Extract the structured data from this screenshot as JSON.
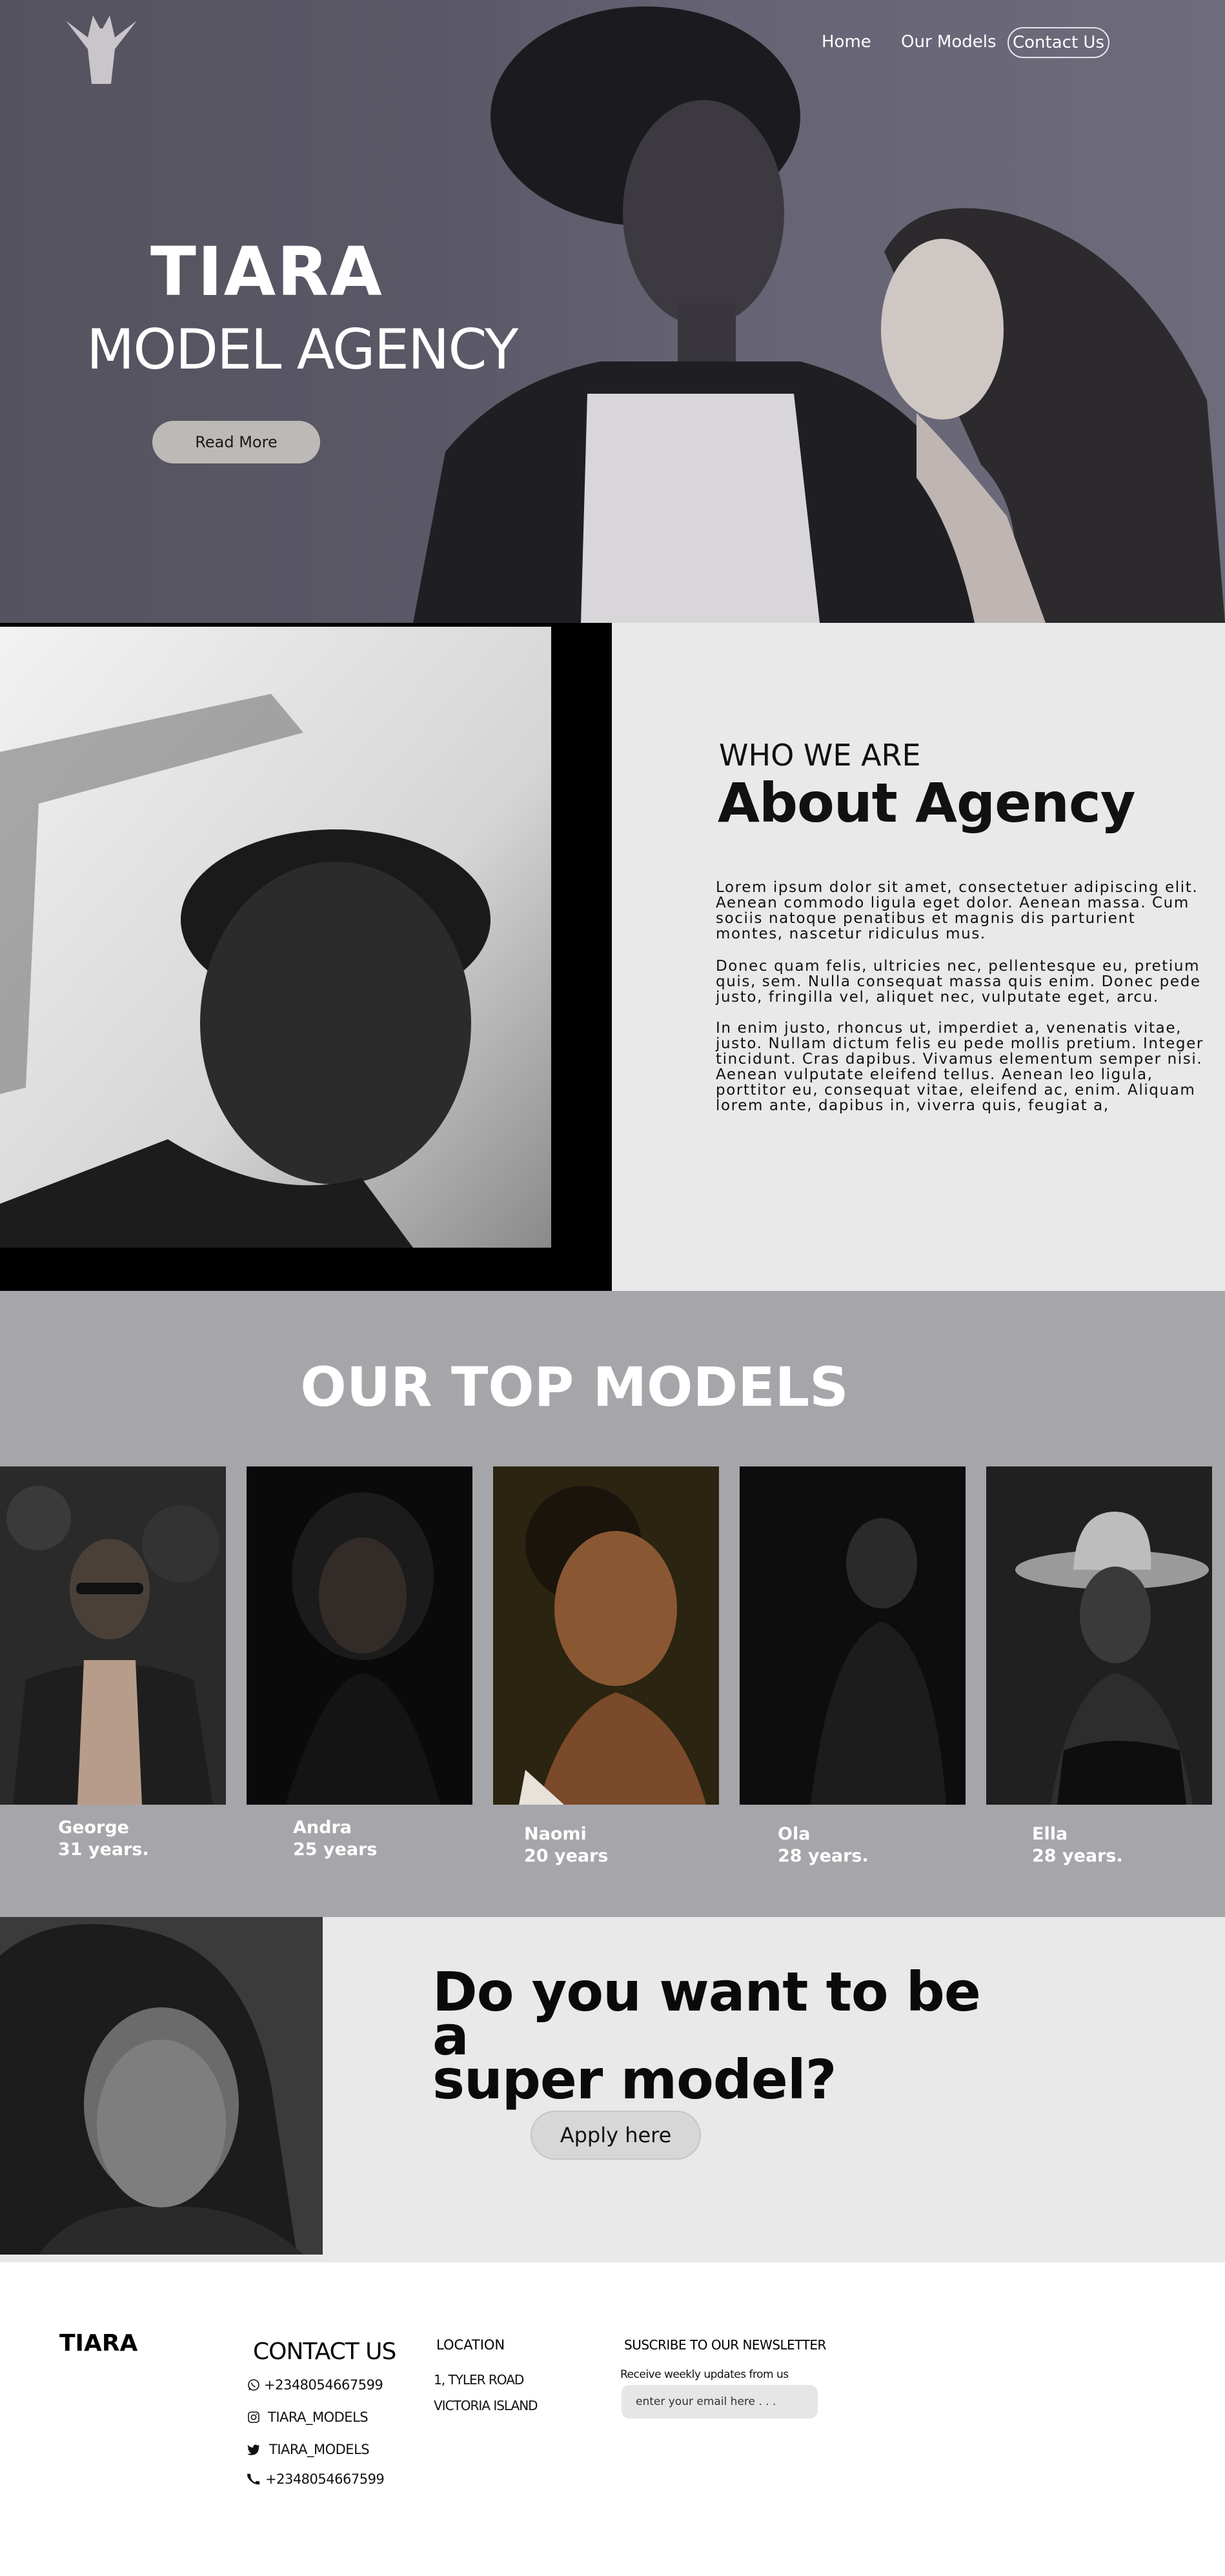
{
  "brand": {
    "logo_icon": "crown-figure-logo-icon"
  },
  "nav": {
    "items": [
      {
        "label": "Home"
      },
      {
        "label": "Our Models"
      },
      {
        "label": "Contact Us"
      }
    ]
  },
  "hero": {
    "title": "TIARA",
    "subtitle": "MODEL AGENCY",
    "cta_label": "Read More"
  },
  "about": {
    "kicker": "WHO WE ARE",
    "title": "About Agency",
    "paragraphs": [
      "Lorem ipsum dolor sit amet, consectetuer adipiscing elit. Aenean commodo ligula eget dolor. Aenean massa. Cum sociis natoque penatibus et magnis dis parturient montes, nascetur ridiculus mus.",
      "Donec quam felis, ultricies nec, pellentesque eu, pretium quis, sem. Nulla consequat massa quis enim. Donec pede justo, fringilla vel, aliquet nec, vulputate eget, arcu.",
      "In enim justo, rhoncus ut, imperdiet a, venenatis vitae, justo. Nullam dictum felis eu pede mollis pretium. Integer tincidunt. Cras dapibus. Vivamus elementum semper nisi. Aenean vulputate eleifend tellus. Aenean leo ligula, porttitor eu, consequat vitae, eleifend ac, enim. Aliquam lorem ante, dapibus in, viverra quis, feugiat a,"
    ]
  },
  "models": {
    "title": "OUR TOP MODELS",
    "items": [
      {
        "name": "George",
        "age": "31 years."
      },
      {
        "name": "Andra",
        "age": "25 years"
      },
      {
        "name": "Naomi",
        "age": "20 years"
      },
      {
        "name": "Ola",
        "age": "28 years."
      },
      {
        "name": "Ella",
        "age": "28 years."
      }
    ]
  },
  "cta": {
    "title_line1": "Do you want to be a",
    "title_line2": "super model?",
    "button_label": "Apply here"
  },
  "footer": {
    "brand": "TIARA",
    "contact_title": "CONTACT US",
    "contacts": [
      {
        "icon": "whatsapp-icon",
        "text": "+2348054667599"
      },
      {
        "icon": "instagram-icon",
        "text": "TIARA_MODELS"
      },
      {
        "icon": "twitter-icon",
        "text": "TIARA_MODELS"
      },
      {
        "icon": "phone-icon",
        "text": "+2348054667599"
      }
    ],
    "location_title": "LOCATION",
    "location_lines": [
      "1, TYLER ROAD",
      "VICTORIA ISLAND"
    ],
    "newsletter_title": "SUSCRIBE TO OUR NEWSLETTER",
    "newsletter_sub": "Receive weekly updates from us",
    "newsletter_placeholder": "enter your email here . . ."
  }
}
